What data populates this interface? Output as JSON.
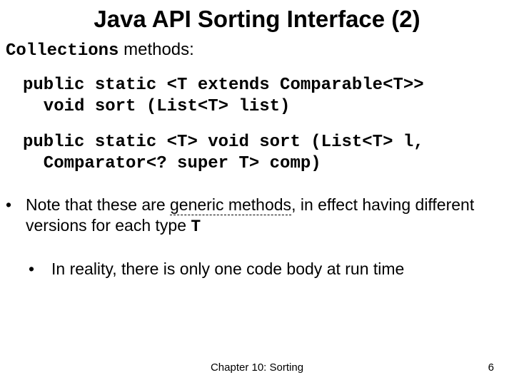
{
  "title": "Java API Sorting Interface (2)",
  "subtitle_code": "Collections",
  "subtitle_rest": " methods:",
  "code1": "public static <T extends Comparable<T>>\n  void sort (List<T> list)",
  "code2": "public static <T> void sort (List<T> l,\n  Comparator<? super T> comp)",
  "bullet1_a": "Note that these are ",
  "bullet1_u": "generic methods",
  "bullet1_b": ", in effect having different versions for each type ",
  "bullet1_c": "T",
  "bullet2": "In reality, there is only one code body at run time",
  "footer_center": "Chapter 10: Sorting",
  "footer_right": "6"
}
